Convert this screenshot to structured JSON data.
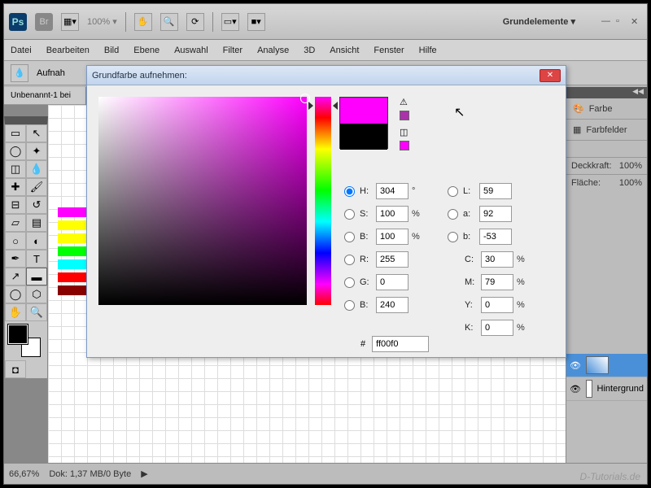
{
  "app": {
    "workspace": "Grundelemente ▾",
    "zoom_toolbar": "100% ▾"
  },
  "menu": {
    "file": "Datei",
    "edit": "Bearbeiten",
    "image": "Bild",
    "layer": "Ebene",
    "select": "Auswahl",
    "filter": "Filter",
    "analysis": "Analyse",
    "threed": "3D",
    "view": "Ansicht",
    "window": "Fenster",
    "help": "Hilfe"
  },
  "options": {
    "sample": "Aufnah"
  },
  "doc": {
    "tab": "Unbenannt-1 bei"
  },
  "panels": {
    "color_label": "Farbe",
    "swatches_label": "Farbfelder",
    "opacity_label": "Deckkraft:",
    "opacity_val": "100%",
    "fill_label": "Fläche:",
    "fill_val": "100%",
    "layer_bg": "Hintergrund"
  },
  "status": {
    "zoom": "66,67%",
    "doc": "Dok: 1,37 MB/0 Byte"
  },
  "watermark": "D-Tutorials.de",
  "picker": {
    "title": "Grundfarbe aufnehmen:",
    "H": {
      "label": "H:",
      "val": "304",
      "unit": "°"
    },
    "S": {
      "label": "S:",
      "val": "100",
      "unit": "%"
    },
    "Bv": {
      "label": "B:",
      "val": "100",
      "unit": "%"
    },
    "R": {
      "label": "R:",
      "val": "255"
    },
    "G": {
      "label": "G:",
      "val": "0"
    },
    "Bc": {
      "label": "B:",
      "val": "240"
    },
    "L": {
      "label": "L:",
      "val": "59"
    },
    "a": {
      "label": "a:",
      "val": "92"
    },
    "b": {
      "label": "b:",
      "val": "-53"
    },
    "C": {
      "label": "C:",
      "val": "30",
      "unit": "%"
    },
    "M": {
      "label": "M:",
      "val": "79",
      "unit": "%"
    },
    "Y": {
      "label": "Y:",
      "val": "0",
      "unit": "%"
    },
    "K": {
      "label": "K:",
      "val": "0",
      "unit": "%"
    },
    "hex_label": "#",
    "hex": "ff00f0"
  },
  "swatches": [
    "#f0f",
    "#ff0",
    "#ff0",
    "#0f0",
    "#0ff",
    "#f00",
    "#800"
  ]
}
